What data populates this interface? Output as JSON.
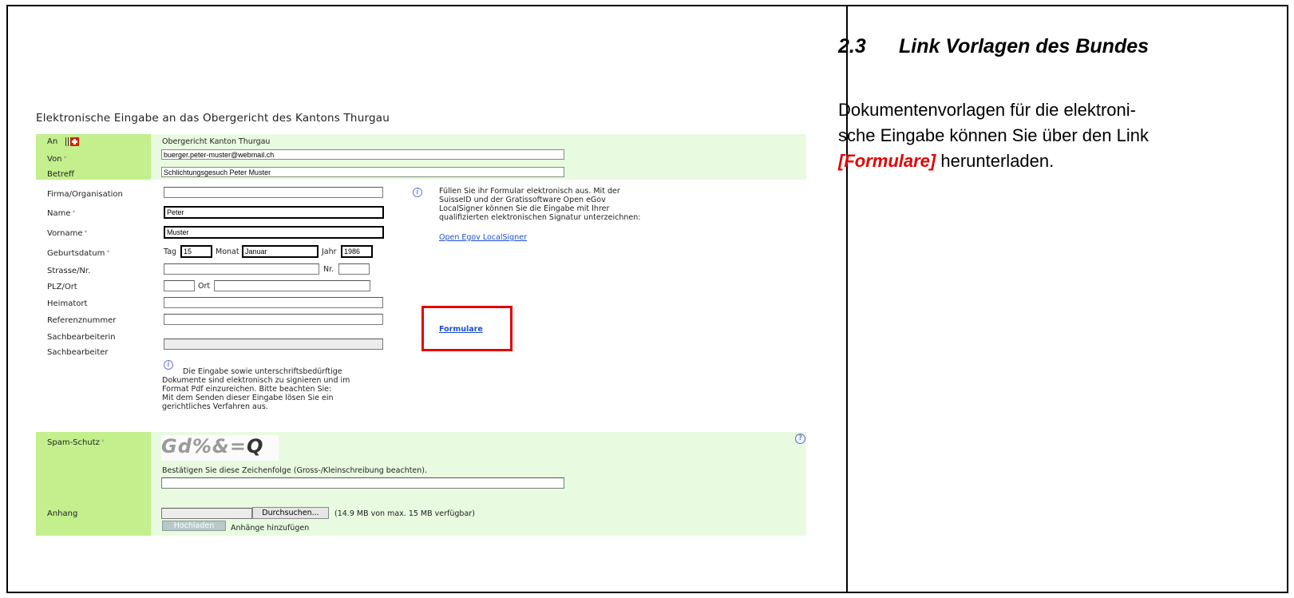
{
  "doc": {
    "heading_number": "2.3",
    "heading_title": "Link Vorlagen des Bundes",
    "line1": "Dokumentenvorlagen für die elektroni-",
    "line2": "sche Eingabe können Sie über den Link",
    "link": "[Formulare]",
    "line3_rest": " herunterladen."
  },
  "form": {
    "title": "Elektronische Eingabe an das Obergericht des Kantons Thurgau",
    "header": {
      "an_label": "An",
      "an_value": "Obergericht Kanton Thurgau",
      "von_label": "Von",
      "von_value": "buerger.peter-muster@webmail.ch",
      "betreff_label": "Betreff",
      "betreff_value": "Schlichtungsgesuch Peter Muster"
    },
    "fields": {
      "firma_label": "Firma/Organisation",
      "firma_value": "",
      "name_label": "Name",
      "name_value": "Peter",
      "vorname_label": "Vorname",
      "vorname_value": "Muster",
      "geburtsdatum_label": "Geburtsdatum",
      "tag_label": "Tag",
      "tag_value": "15",
      "monat_label": "Monat",
      "monat_value": "Januar",
      "jahr_label": "Jahr",
      "jahr_value": "1986",
      "strasse_label": "Strasse/Nr.",
      "nr_label": "Nr.",
      "plz_label": "PLZ/Ort",
      "ort_label": "Ort",
      "heimatort_label": "Heimatort",
      "referenz_label": "Referenznummer",
      "sachbearbeiterin_label": "Sachbearbeiterin",
      "sachbearbeiter_label": "Sachbearbeiter",
      "required_mark": "*"
    },
    "info_text": {
      "l1": "Füllen Sie ihr Formular elektronisch aus. Mit der",
      "l2": "SuisseID und der Gratissoftware Open eGov",
      "l3": "LocalSigner können Sie die Eingabe mit Ihrer",
      "l4": "qualifizierten elektronischen Signatur unterzeichnen:",
      "link": "Open Egov LocalSigner"
    },
    "formulare_link": "Formulare",
    "note": {
      "l1": "Die Eingabe sowie unterschriftsbedürftige",
      "l2": "Dokumente sind elektronisch zu signieren und im",
      "l3": "Format Pdf einzureichen. Bitte beachten Sie:",
      "l4": "Mit dem Senden dieser Eingabe lösen Sie ein",
      "l5": "gerichtliches Verfahren aus."
    },
    "spam": {
      "label": "Spam-Schutz",
      "captcha_faint": "Gd%&=",
      "captcha_strong": "Q",
      "instruction": "Bestätigen Sie diese Zeichenfolge (Gross-/Kleinschreibung beachten).",
      "value": "",
      "help": "?"
    },
    "anhang": {
      "label": "Anhang",
      "browse_button": "Durchsuchen...",
      "quota": "(14.9 MB von max. 15 MB verfügbar)",
      "upload_button": "Hochladen",
      "add_text": "Anhänge hinzufügen"
    },
    "info_glyph": "i"
  },
  "colors": {
    "label_green": "#c3f08c",
    "panel_green": "#e8fbe0",
    "highlight_red": "#e60000",
    "link_blue": "#1a4fd0"
  }
}
